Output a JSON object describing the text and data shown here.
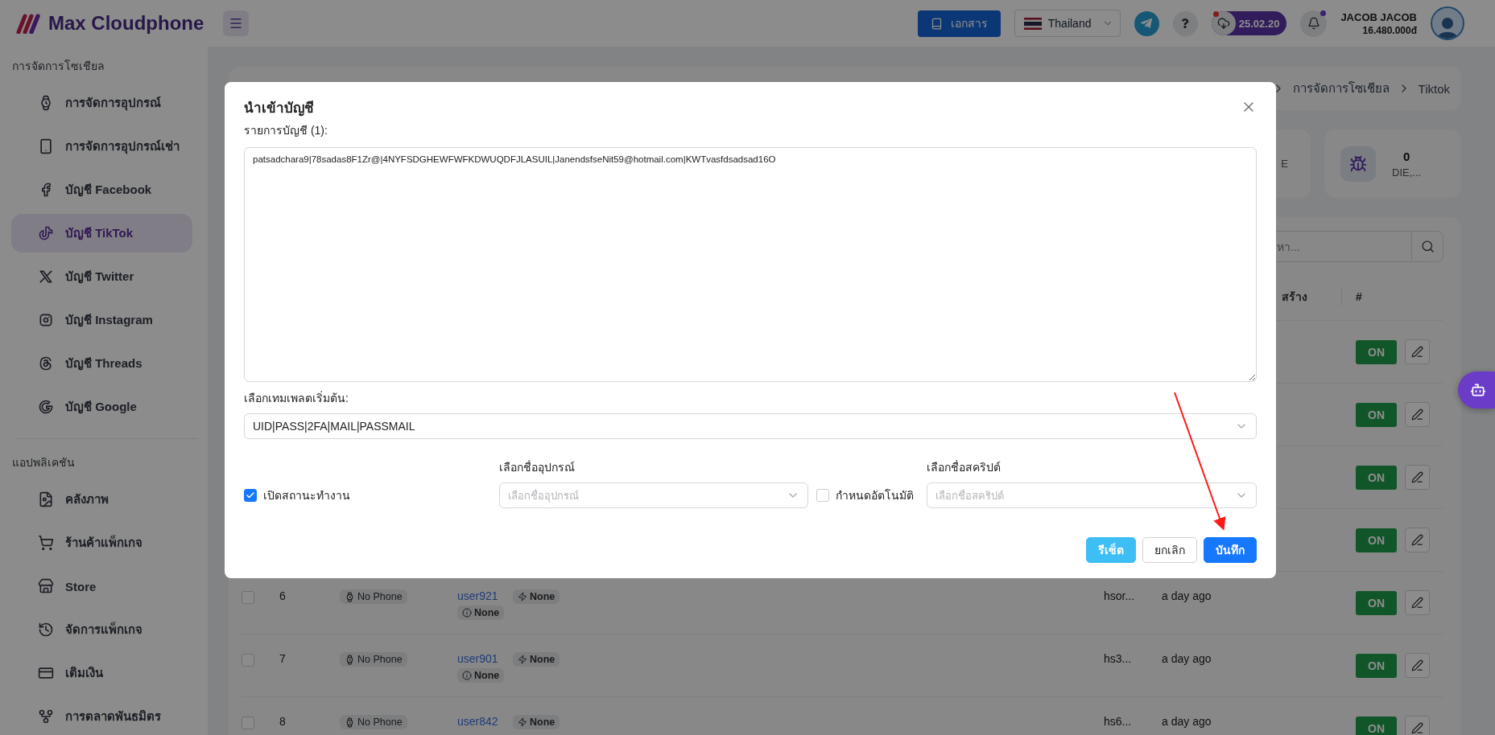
{
  "header": {
    "brand": "Max Cloudphone",
    "docs_button": "เอกสาร",
    "language": "Thailand",
    "version": "25.02.20",
    "user": {
      "name": "JACOB JACOB",
      "balance": "16.480.000đ"
    }
  },
  "sidebar": {
    "sections": [
      {
        "title": "การจัดการโซเชียล",
        "items": [
          {
            "label": "การจัดการอุปกรณ์",
            "selected": false
          },
          {
            "label": "การจัดการอุปกรณ์เช่า",
            "selected": false
          },
          {
            "label": "บัญชี Facebook",
            "selected": false
          },
          {
            "label": "บัญชี TikTok",
            "selected": true
          },
          {
            "label": "บัญชี Twitter",
            "selected": false
          },
          {
            "label": "บัญชี Instagram",
            "selected": false
          },
          {
            "label": "บัญชี Threads",
            "selected": false
          },
          {
            "label": "บัญชี Google",
            "selected": false
          }
        ]
      },
      {
        "title": "แอปพลิเคชัน",
        "items": [
          {
            "label": "คลังภาพ",
            "selected": false
          },
          {
            "label": "ร้านค้าแพ็กเกจ",
            "selected": false
          },
          {
            "label": "Store",
            "selected": false
          },
          {
            "label": "จัดการแพ็กเกจ",
            "selected": false
          },
          {
            "label": "เติมเงิน",
            "selected": false
          },
          {
            "label": "การตลาดพันธมิตร",
            "selected": false
          }
        ]
      }
    ]
  },
  "breadcrumb": [
    "การจัดการโซเชียล",
    "Tiktok"
  ],
  "stats": [
    {
      "kind": "partial",
      "label": "E"
    },
    {
      "kind": "full",
      "value": "0",
      "label": "DIE,..."
    }
  ],
  "search": {
    "placeholder": "หา..."
  },
  "table": {
    "columns": [
      "สร้าง",
      "#"
    ],
    "rows": [
      {
        "kind": "partial",
        "toggle": "ON",
        "on": true
      },
      {
        "kind": "partial",
        "toggle": "ON",
        "on": true
      },
      {
        "kind": "partial",
        "toggle": "ON",
        "on": true
      },
      {
        "kind": "partial",
        "toggle": "ON",
        "on": true
      },
      {
        "kind": "full",
        "checked": false,
        "index": "6",
        "device": "No Phone",
        "user": "user921",
        "proxy": "None",
        "status": "None",
        "name": "hsor...",
        "created": "a day ago",
        "toggle": "ON",
        "on": true
      },
      {
        "kind": "full",
        "checked": false,
        "index": "7",
        "device": "No Phone",
        "user": "user901",
        "proxy": "None",
        "status": "None",
        "name": "hs3...",
        "created": "a day ago",
        "toggle": "ON",
        "on": true
      },
      {
        "kind": "full",
        "checked": false,
        "index": "8",
        "device": "No Phone",
        "user": "user842",
        "proxy": "None",
        "name": "hs6...",
        "created": "a day ago",
        "toggle": "ON",
        "on": true
      }
    ]
  },
  "dialog": {
    "title": "นำเข้าบัญชี",
    "list_label": "รายการบัญชี (1):",
    "accounts_text": "patsadchara9|78sadas8F1Zr@|4NYFSDGHEWFWFKDWUQDFJLASUIL|JanendsfseNit59@hotmail.com|KWTvasfdsadsad16O",
    "template_label": "เลือกเทมเพลตเริ่มต้น:",
    "template_value": "UID|PASS|2FA|MAIL|PASSMAIL",
    "active_checkbox": {
      "label": "เปิดสถานะทำงาน",
      "checked": true
    },
    "device": {
      "label": "เลือกชื่ออุปกรณ์",
      "placeholder": "เลือกชื่ออุปกรณ์"
    },
    "auto_checkbox": {
      "label": "กำหนดอัตโนมัติ",
      "checked": false
    },
    "script": {
      "label": "เลือกชื่อสคริปต์",
      "placeholder": "เลือกชื่อสคริปต์"
    },
    "buttons": [
      {
        "label": "รีเซ็ต",
        "kind": "reset"
      },
      {
        "label": "ยกเลิก",
        "kind": "cancel"
      },
      {
        "label": "บันทึก",
        "kind": "primary"
      }
    ]
  }
}
